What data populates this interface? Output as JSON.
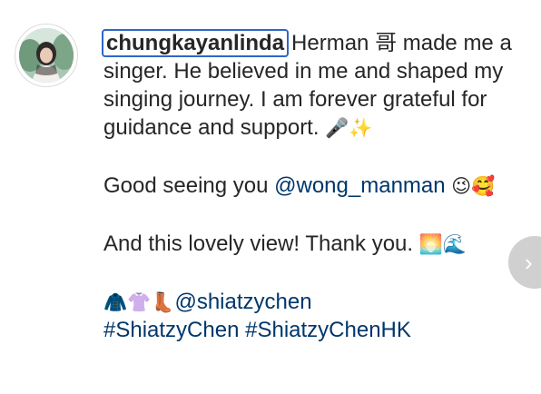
{
  "author": {
    "username": "chungkayanlinda",
    "avatar_icon": "profile-photo"
  },
  "caption": {
    "line1_rest": "Herman 哥 made me a",
    "line2": "singer. He believed in me and shaped my",
    "line3": "singing journey. I am forever grateful for",
    "line4_text": "guidance and support.",
    "line4_emoji": "🎤✨",
    "line5_text": "Good seeing you",
    "line5_mention": "@wong_manman",
    "line5_emoji": "😉🥰",
    "line6_text": "And this lovely view! Thank you.",
    "line6_emoji": "🌅🌊",
    "line7_emoji": "🧥👚👢",
    "line7_mention": "@shiatzychen",
    "hashtag1": "#ShiatzyChen",
    "hashtag2": "#ShiatzyChenHK"
  },
  "next_button": {
    "icon": "chevron-right-icon",
    "glyph": "›"
  },
  "colors": {
    "text": "#262626",
    "link": "#00376b",
    "focus_outline": "#2f66c9"
  }
}
